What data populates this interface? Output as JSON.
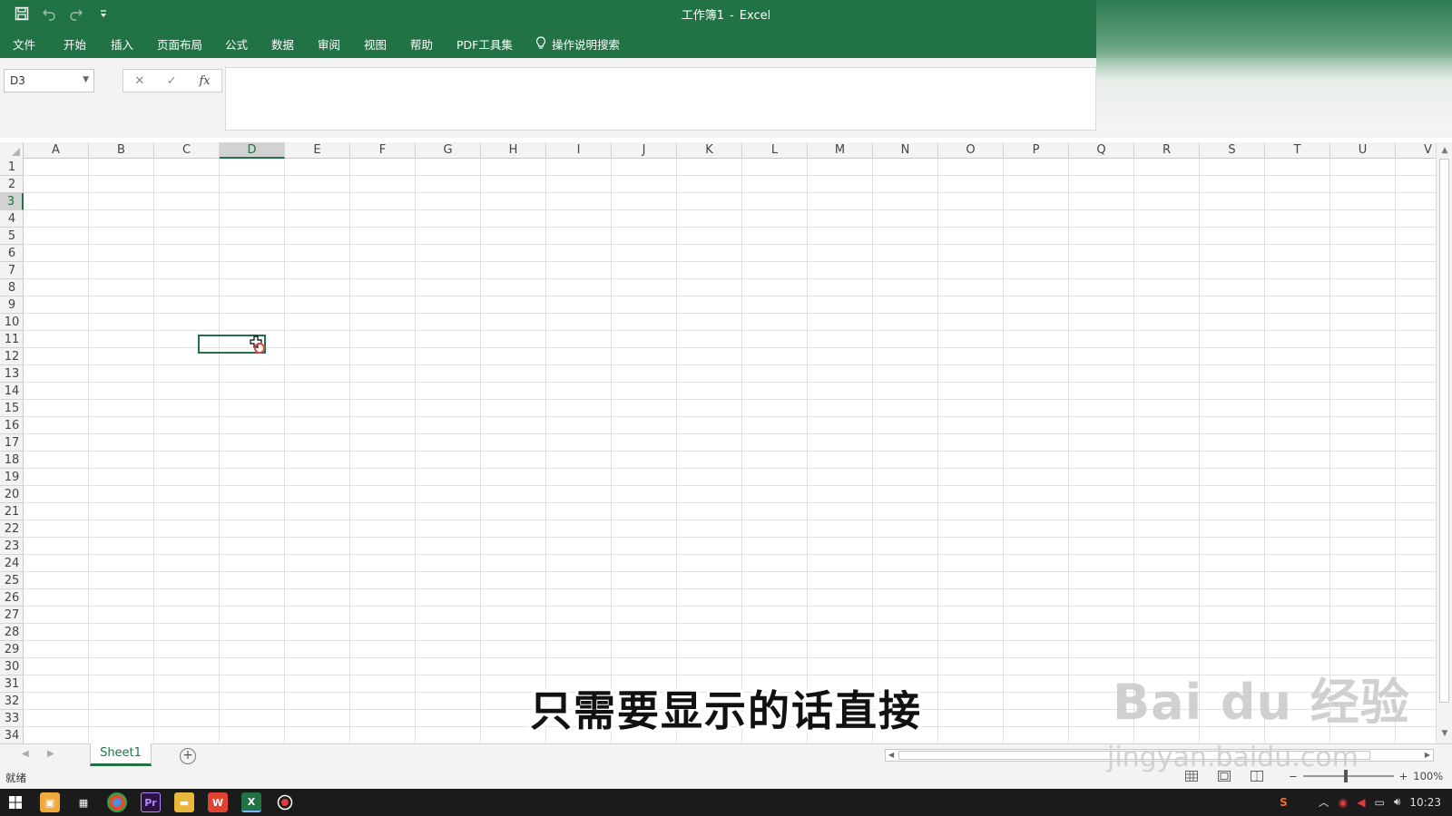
{
  "window": {
    "title_doc": "工作簿1",
    "title_sep": "-",
    "title_app": "Excel"
  },
  "qat": {
    "save": "save-icon",
    "undo": "undo-icon",
    "redo": "redo-icon",
    "customize": "customize-icon"
  },
  "ribbon": {
    "tabs": [
      "文件",
      "开始",
      "插入",
      "页面布局",
      "公式",
      "数据",
      "审阅",
      "视图",
      "帮助",
      "PDF工具集"
    ],
    "tell_me": "操作说明搜索"
  },
  "formula_bar": {
    "name_box": "D3",
    "cancel": "✕",
    "enter": "✓",
    "fx": "fx",
    "content": ""
  },
  "columns": [
    "A",
    "B",
    "C",
    "D",
    "E",
    "F",
    "G",
    "H",
    "I",
    "J",
    "K",
    "L",
    "M",
    "N",
    "O",
    "P",
    "Q",
    "R",
    "S",
    "T",
    "U",
    "V"
  ],
  "rows": [
    "1",
    "2",
    "3",
    "4",
    "5",
    "6",
    "7",
    "8",
    "9",
    "10",
    "11",
    "12",
    "13",
    "14",
    "15",
    "16",
    "17",
    "18",
    "19",
    "20",
    "21",
    "22",
    "23",
    "24",
    "25",
    "26",
    "27",
    "28",
    "29",
    "30",
    "31",
    "32",
    "33",
    "34"
  ],
  "selection": {
    "column": "D",
    "row": "3"
  },
  "sheets": {
    "tabs": [
      "Sheet1"
    ],
    "add": "+"
  },
  "status": {
    "ready": "就绪",
    "zoom": "100%",
    "zoom_minus": "−",
    "zoom_plus": "+"
  },
  "taskbar": {
    "time": "10:23"
  },
  "overlay": {
    "subtitle": "只需要显示的话直接",
    "watermark_brand": "Bai du 经验",
    "watermark_url": "jingyan.baidu.com"
  },
  "colors": {
    "accent": "#217346",
    "taskbar": "#1b1b1b"
  }
}
